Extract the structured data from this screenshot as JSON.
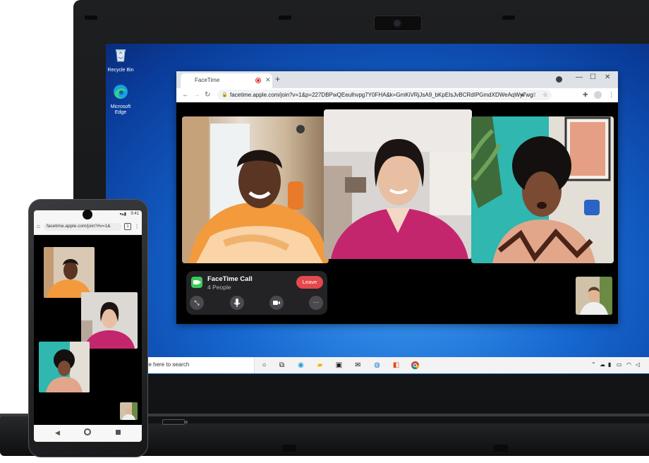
{
  "desktop": {
    "icons": [
      {
        "label": "Recycle Bin",
        "icon": "recycle-bin-icon"
      },
      {
        "label": "Microsoft Edge",
        "icon": "edge-icon"
      }
    ]
  },
  "browser": {
    "tab_title": "FaceTime",
    "url": "facetime.apple.com/join?v=1&p=227DBPwQEeulhvpg7Y0FHA&k=GmKiVRjJsA9_bKpEIsJvBCRdIPGmdXDWeAqWy7wg",
    "new_tab_symbol": "+",
    "window_controls": {
      "minimize": "—",
      "maximize": "☐",
      "close": "✕"
    }
  },
  "call": {
    "title": "FaceTime Call",
    "subtitle": "4 People",
    "leave_label": "Leave",
    "controls": [
      {
        "name": "expand-button",
        "icon": "expand-icon",
        "glyph": "⤡"
      },
      {
        "name": "mute-button",
        "icon": "microphone-icon",
        "glyph": "🎤"
      },
      {
        "name": "camera-button",
        "icon": "video-camera-icon",
        "glyph": "■"
      },
      {
        "name": "more-button",
        "icon": "ellipsis-icon",
        "glyph": "···"
      }
    ],
    "participants": [
      "participant-orange-hoodie",
      "participant-magenta-cardigan",
      "participant-patterned-top",
      "participant-self-view"
    ]
  },
  "taskbar": {
    "search_placeholder": "pe here to search",
    "pinned": [
      "task-view-icon",
      "edge-icon",
      "file-explorer-icon",
      "store-icon",
      "mail-icon",
      "dell-icon",
      "office-icon",
      "chrome-icon"
    ]
  },
  "phone": {
    "time": "9:41",
    "url": "facetime.apple.com/join?#v=1&",
    "tab_count": "1"
  },
  "colors": {
    "leave_red": "#e5484d",
    "facetime_green": "#3ac95b",
    "desktop_blue": "#1566cf"
  }
}
